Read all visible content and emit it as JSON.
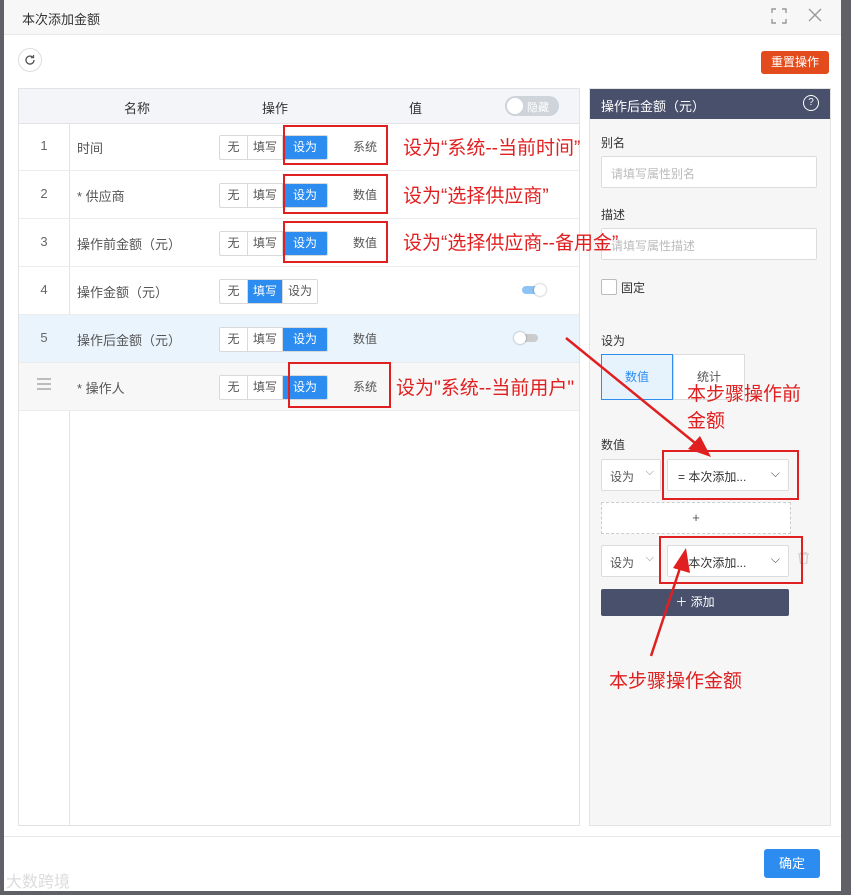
{
  "window": {
    "title": "本次添加金额"
  },
  "toolbar": {
    "reset_label": "重置操作"
  },
  "table": {
    "headers": {
      "name": "名称",
      "action": "操作",
      "value": "值"
    },
    "hide_toggle_label": "隐藏",
    "rows": [
      {
        "num": "1",
        "name": "时间",
        "options": [
          "无",
          "填写",
          "设为"
        ],
        "selected": "设为",
        "value": "系统"
      },
      {
        "num": "2",
        "name": "* 供应商",
        "options": [
          "无",
          "填写",
          "设为"
        ],
        "selected": "设为",
        "value": "数值"
      },
      {
        "num": "3",
        "name": "操作前金额（元）",
        "options": [
          "无",
          "填写",
          "设为"
        ],
        "selected": "设为",
        "value": "数值"
      },
      {
        "num": "4",
        "name": "操作金额（元）",
        "options": [
          "无",
          "填写",
          "设为"
        ],
        "selected": "填写",
        "value": ""
      },
      {
        "num": "5",
        "name": "操作后金额（元）",
        "options": [
          "无",
          "填写",
          "设为"
        ],
        "selected": "设为",
        "value": "数值"
      },
      {
        "num": "",
        "name": "* 操作人",
        "options": [
          "无",
          "填写",
          "设为"
        ],
        "selected": "设为",
        "value": "系统"
      }
    ]
  },
  "annotations": {
    "a1": "设为“系统--当前时间”",
    "a2": "设为“选择供应商”",
    "a3": "设为“选择供应商--备用金”",
    "a4": "设为\"系统--当前用户\"",
    "a5_line1": "本步骤操作前",
    "a5_line2": "金额",
    "a6": "本步骤操作金额"
  },
  "panel": {
    "title": "操作后金额（元）",
    "alias_label": "别名",
    "alias_placeholder": "请填写属性别名",
    "desc_label": "描述",
    "desc_placeholder": "请填写属性描述",
    "fixed_label": "固定",
    "set_label": "设为",
    "tabs": [
      "数值",
      "统计"
    ],
    "active_tab": "数值",
    "value_label": "数值",
    "select1": {
      "mode": "设为",
      "value": "= 本次添加..."
    },
    "plus_label": "+",
    "select2": {
      "mode": "设为",
      "value": "= 本次添加..."
    },
    "add_label": "添加"
  },
  "footer": {
    "ok_label": "确定"
  },
  "watermark": "大数跨境",
  "colors": {
    "accent": "#2d8cf0",
    "danger": "#e44b1c",
    "annotation": "#e02020",
    "panel_header": "#48506b"
  }
}
